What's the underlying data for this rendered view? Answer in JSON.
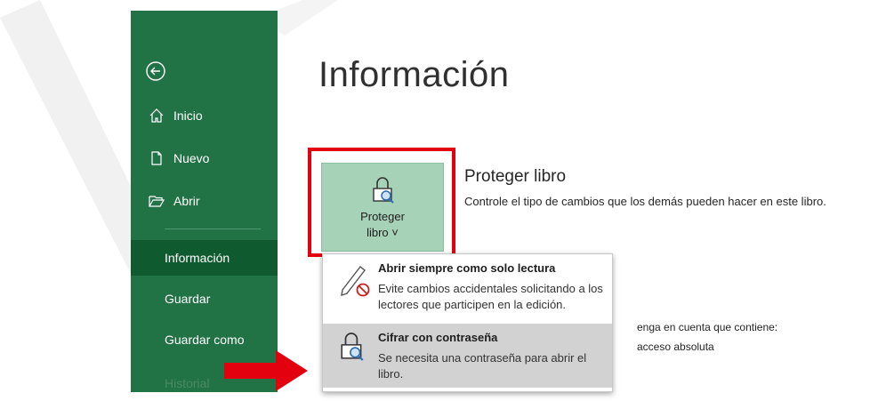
{
  "sidebar": {
    "items": [
      {
        "label": "Inicio",
        "icon": "home-icon"
      },
      {
        "label": "Nuevo",
        "icon": "new-document-icon"
      },
      {
        "label": "Abrir",
        "icon": "folder-open-icon"
      },
      {
        "label": "Información"
      },
      {
        "label": "Guardar"
      },
      {
        "label": "Guardar como"
      },
      {
        "label": "Historial"
      }
    ]
  },
  "main": {
    "title": "Información",
    "protect": {
      "button_line1": "Proteger",
      "button_line2": "libro",
      "heading": "Proteger libro",
      "description": "Controle el tipo de cambios que los demás pueden hacer en este libro."
    },
    "background_text": {
      "line1": "enga en cuenta que contiene:",
      "line2": "acceso absoluta"
    }
  },
  "menu": {
    "items": [
      {
        "title": "Abrir siempre como solo lectura",
        "description": "Evite cambios accidentales solicitando a los lectores que participen en la edición.",
        "icon": "read-only-pencil-icon"
      },
      {
        "title": "Cifrar con contraseña",
        "description": "Se necesita una contraseña para abrir el libro.",
        "icon": "lock-key-icon"
      }
    ]
  },
  "colors": {
    "sidebar": "#217346",
    "sidebar_active": "#0f5b2f",
    "protect_tile": "#a6d2b7",
    "highlight_box": "#e3000f",
    "arrow": "#e3000f"
  }
}
